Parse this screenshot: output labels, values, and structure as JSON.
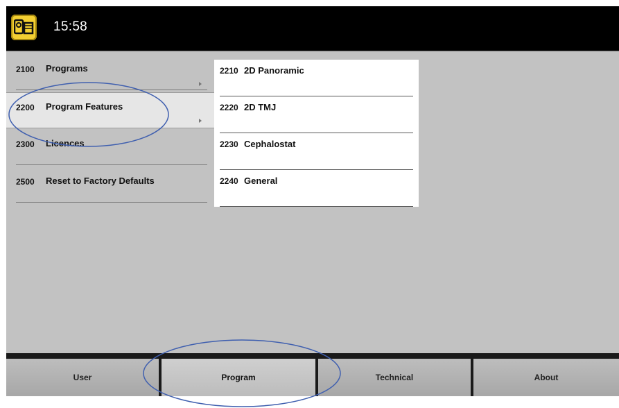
{
  "header": {
    "time": "15:58",
    "app_icon": "x-ray-machine-icon"
  },
  "menu": {
    "items": [
      {
        "code": "2100",
        "label": "Programs",
        "has_submenu": true
      },
      {
        "code": "2200",
        "label": "Program Features",
        "has_submenu": true,
        "selected": true
      },
      {
        "code": "2300",
        "label": "Licences",
        "has_submenu": false
      },
      {
        "code": "2500",
        "label": "Reset to Factory Defaults",
        "has_submenu": false
      }
    ]
  },
  "submenu": {
    "items": [
      {
        "code": "2210",
        "label": "2D Panoramic"
      },
      {
        "code": "2220",
        "label": "2D TMJ"
      },
      {
        "code": "2230",
        "label": "Cephalostat"
      },
      {
        "code": "2240",
        "label": "General"
      }
    ]
  },
  "tabs": [
    {
      "label": "User"
    },
    {
      "label": "Program",
      "active": true
    },
    {
      "label": "Technical"
    },
    {
      "label": "About"
    }
  ],
  "annotation_color": "#3f5faf",
  "accent_color": "#f3cf32"
}
